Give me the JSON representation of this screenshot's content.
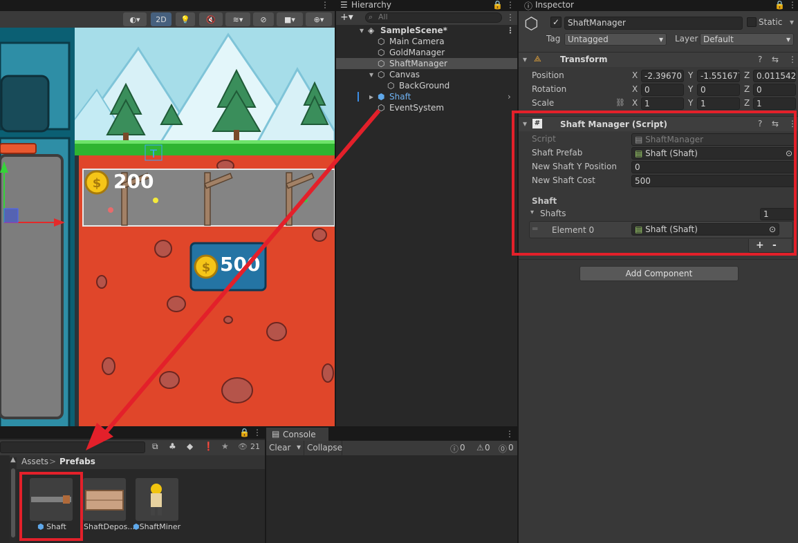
{
  "scene": {
    "toolbar": {
      "mode_2d": "2D"
    },
    "coin_label_top": "200",
    "coin_label_button": "500"
  },
  "hierarchy": {
    "tab": "Hierarchy",
    "search_placeholder": "All",
    "items": [
      {
        "label": "SampleScene*"
      },
      {
        "label": "Main Camera"
      },
      {
        "label": "GoldManager"
      },
      {
        "label": "ShaftManager"
      },
      {
        "label": "Canvas"
      },
      {
        "label": "BackGround"
      },
      {
        "label": "Shaft"
      },
      {
        "label": "EventSystem"
      }
    ]
  },
  "inspector": {
    "tab": "Inspector",
    "object_name": "ShaftManager",
    "static_label": "Static",
    "tag_label": "Tag",
    "tag_value": "Untagged",
    "layer_label": "Layer",
    "layer_value": "Default",
    "transform": {
      "title": "Transform",
      "position_label": "Position",
      "rotation_label": "Rotation",
      "scale_label": "Scale",
      "x": "X",
      "y": "Y",
      "z": "Z",
      "position": [
        "-2.39670",
        "-1.551677",
        "0.011542"
      ],
      "rotation": [
        "0",
        "0",
        "0"
      ],
      "scale": [
        "1",
        "1",
        "1"
      ]
    },
    "script_component": {
      "title": "Shaft Manager (Script)",
      "script_label": "Script",
      "script_value": "ShaftManager",
      "prefab_label": "Shaft Prefab",
      "prefab_value": "Shaft (Shaft)",
      "newy_label": "New Shaft Y Position",
      "newy_value": "0",
      "cost_label": "New Shaft Cost",
      "cost_value": "500",
      "section_label": "Shaft",
      "shafts_label": "Shafts",
      "shafts_count": "1",
      "element_label": "Element 0",
      "element_value": "Shaft (Shaft)",
      "plus": "+",
      "minus": "-"
    },
    "add_component": "Add Component"
  },
  "project": {
    "breadcrumb_assets": "Assets",
    "breadcrumb_sep": ">",
    "breadcrumb_folder": "Prefabs",
    "count": "21",
    "assets": [
      {
        "label": "Shaft"
      },
      {
        "label": "ShaftDepos..."
      },
      {
        "label": "ShaftMiner"
      }
    ]
  },
  "console": {
    "tab": "Console",
    "clear": "Clear",
    "collapse": "Collapse",
    "counts": [
      "0",
      "0",
      "0"
    ]
  },
  "colors": {
    "highlight_red": "#e3202a",
    "selection": "#4d4d4d",
    "dirt": "#e0462a",
    "grass": "#2fb431",
    "sky": "#a6dde9"
  }
}
